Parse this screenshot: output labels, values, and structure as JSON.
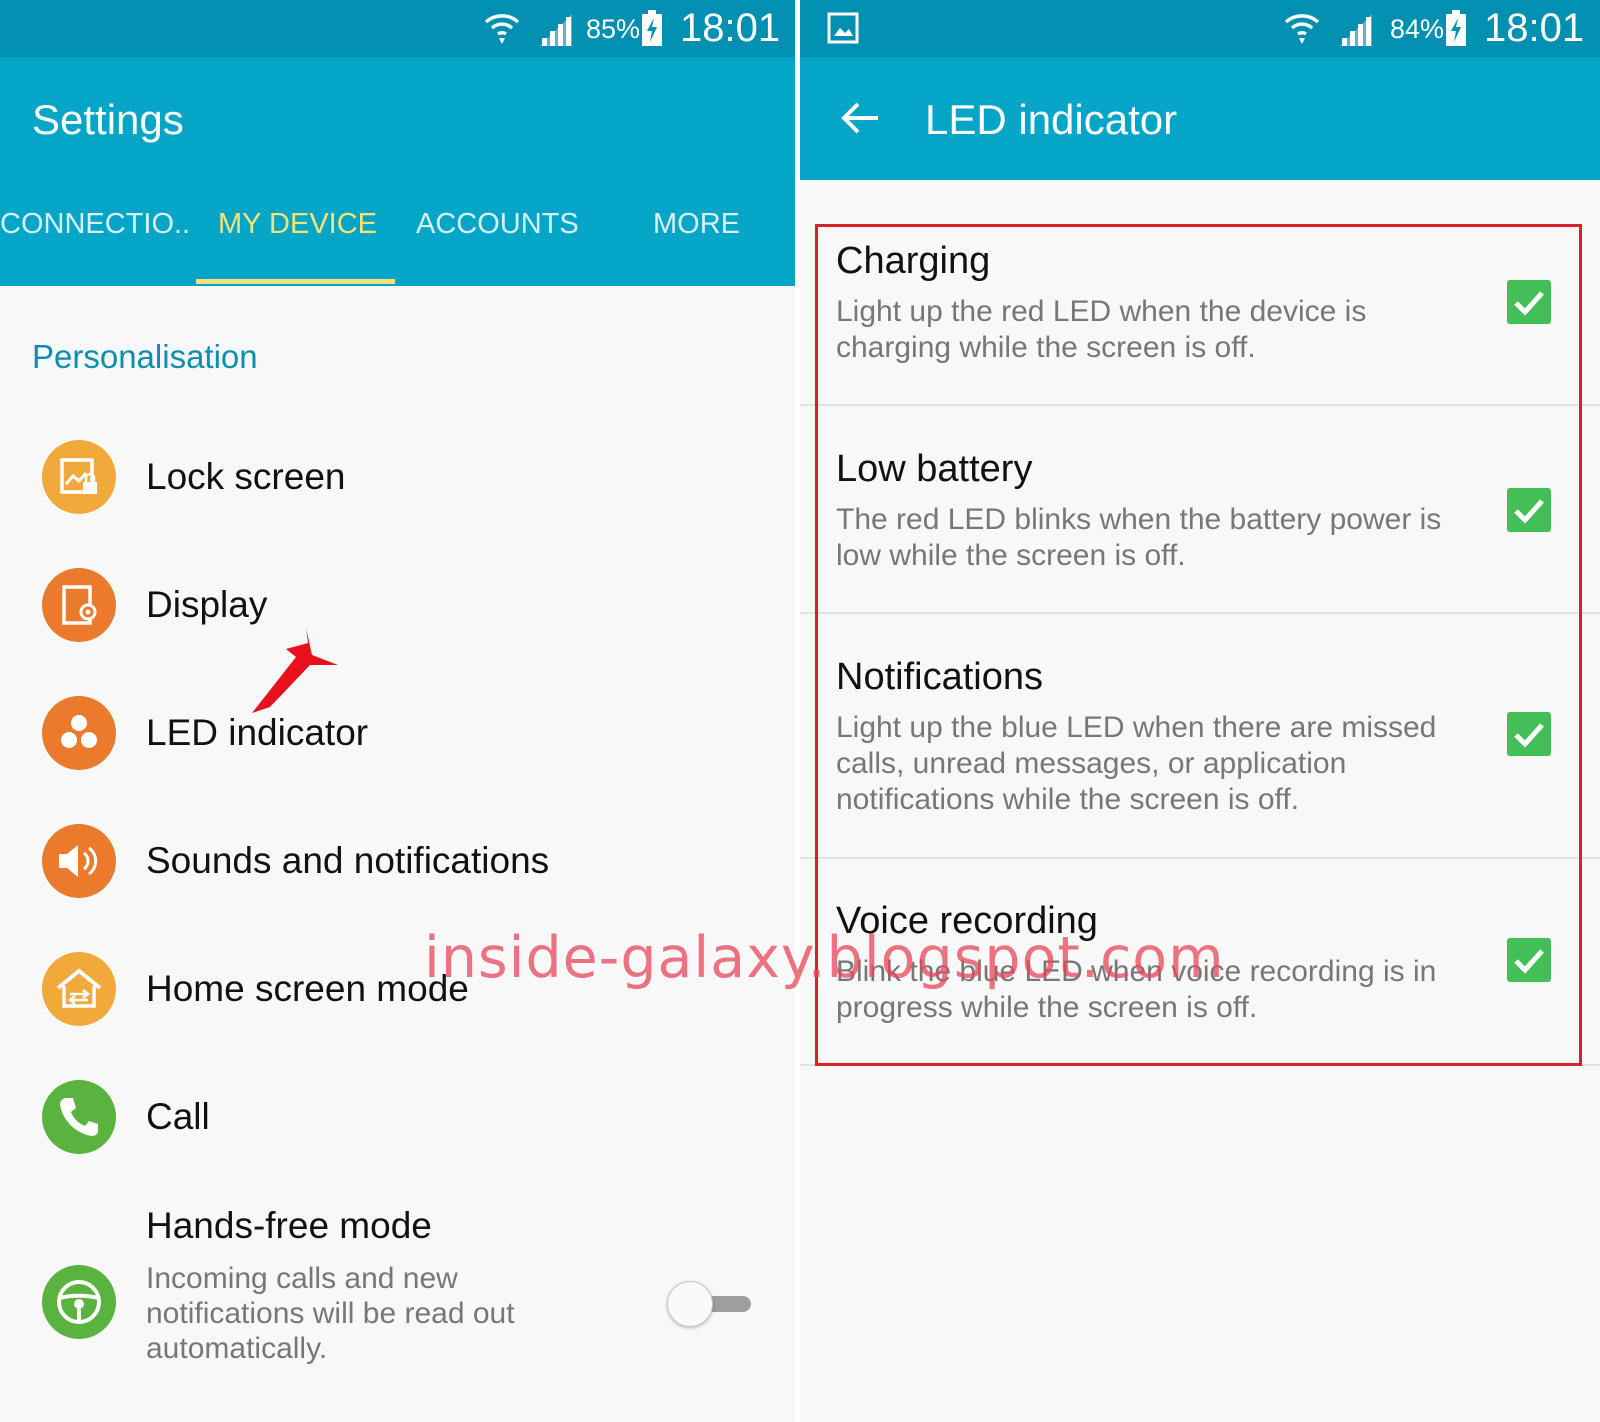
{
  "left": {
    "status": {
      "battery": "85%",
      "time": "18:01"
    },
    "title": "Settings",
    "tabs": [
      {
        "label": "CONNECTIO..",
        "active": false
      },
      {
        "label": "MY DEVICE",
        "active": true
      },
      {
        "label": "ACCOUNTS",
        "active": false
      },
      {
        "label": "MORE",
        "active": false
      }
    ],
    "section": "Personalisation",
    "items": [
      {
        "label": "Lock screen",
        "icon": "lock-screen-icon",
        "color": "#f0a93a"
      },
      {
        "label": "Display",
        "icon": "display-icon",
        "color": "#ec7a2c"
      },
      {
        "label": "LED indicator",
        "icon": "led-indicator-icon",
        "color": "#ec7a2c"
      },
      {
        "label": "Sounds and notifications",
        "icon": "speaker-icon",
        "color": "#ec7a2c"
      },
      {
        "label": "Home screen mode",
        "icon": "home-screen-mode-icon",
        "color": "#f0a93a"
      },
      {
        "label": "Call",
        "icon": "phone-icon",
        "color": "#5ab33e"
      },
      {
        "label": "Hands-free mode",
        "icon": "steering-wheel-icon",
        "color": "#5ab33e",
        "desc": "Incoming calls and new notifications will be read out automatically.",
        "toggle": false
      }
    ]
  },
  "right": {
    "status": {
      "battery": "84%",
      "time": "18:01"
    },
    "title": "LED indicator",
    "items": [
      {
        "title": "Charging",
        "desc": "Light up the red LED when the device is charging while the screen is off.",
        "checked": true
      },
      {
        "title": "Low battery",
        "desc": "The red LED blinks when the battery power is low while the screen is off.",
        "checked": true
      },
      {
        "title": "Notifications",
        "desc": "Light up the blue LED when there are missed calls, unread messages, or application notifications while the screen is off.",
        "checked": true
      },
      {
        "title": "Voice recording",
        "desc": "Blink the blue LED when voice recording is in progress while the screen is off.",
        "checked": true
      }
    ]
  },
  "watermark": "inside-galaxy.blogspot.com",
  "colors": {
    "statusbar": "#0190b1",
    "appbar": "#04a5c7",
    "tab_active": "#f4e27a",
    "accent_text": "#0b8fb0",
    "checkbox": "#43bf57",
    "highlight": "#d9202a",
    "arrow": "#e8101c"
  }
}
